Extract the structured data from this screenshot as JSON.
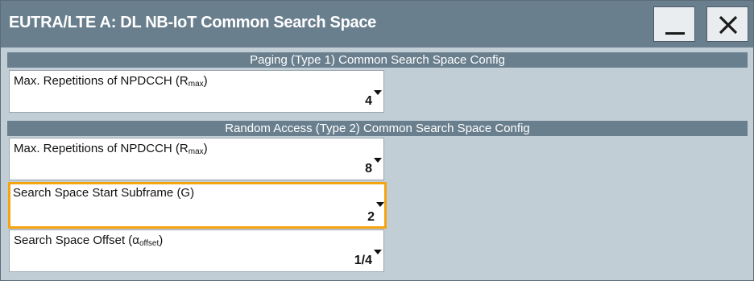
{
  "window": {
    "title": "EUTRA/LTE A: DL NB-IoT Common Search Space",
    "minimize_icon": "minimize-icon",
    "close_icon": "close-icon"
  },
  "sections": [
    {
      "header": "Paging (Type 1) Common Search Space Config",
      "fields": [
        {
          "label": "Max. Repetitions of NPDCCH (R",
          "label_sub": "max",
          "label_suffix": ")",
          "value": "4",
          "focused": false
        }
      ]
    },
    {
      "header": "Random Access (Type 2) Common Search Space Config",
      "fields": [
        {
          "label": "Max. Repetitions of NPDCCH (R",
          "label_sub": "max",
          "label_suffix": ")",
          "value": "8",
          "focused": false
        },
        {
          "label": "Search Space Start Subframe (G)",
          "value": "2",
          "focused": true
        },
        {
          "label": "Search Space Offset (α",
          "label_sub": "offset",
          "label_suffix": ")",
          "value": "1/4",
          "focused": false
        }
      ]
    }
  ],
  "colors": {
    "titlebar": "#6a7f8e",
    "background": "#c2ced6",
    "focus_border": "#f5a40f"
  },
  "icons": {
    "dropdown": "dropdown-arrow-icon"
  }
}
